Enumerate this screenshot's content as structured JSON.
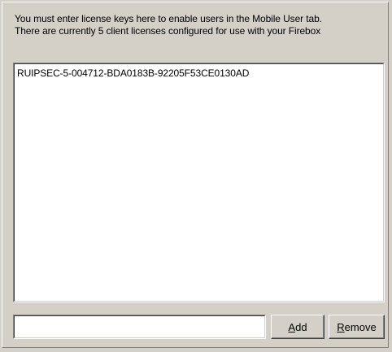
{
  "description": {
    "line1": "You must enter license keys here to enable users in the Mobile User tab.",
    "line2": "There are currently 5 client licenses configured for use with your Firebox"
  },
  "license_list": {
    "items": [
      "RUIPSEC-5-004712-BDA0183B-92205F53CE0130AD"
    ]
  },
  "license_input": {
    "value": ""
  },
  "buttons": {
    "add": {
      "mnemonic": "A",
      "rest": "dd"
    },
    "remove": {
      "mnemonic": "R",
      "rest": "emove"
    }
  }
}
